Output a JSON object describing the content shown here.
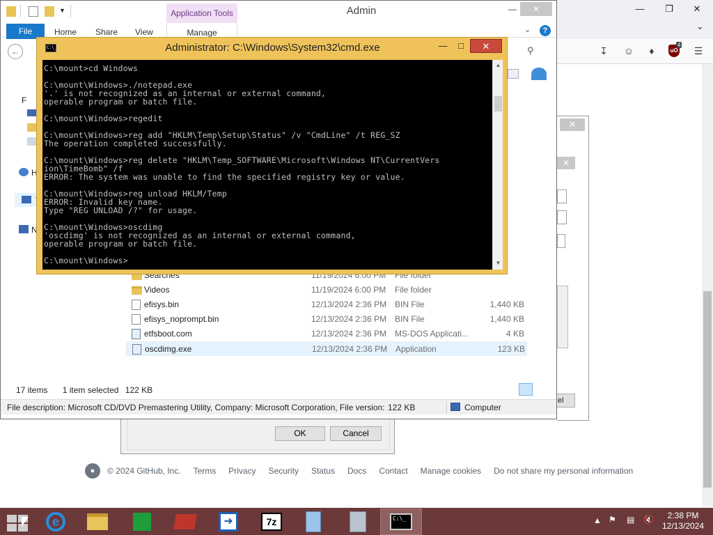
{
  "browser": {
    "footer": {
      "copyright": "© 2024 GitHub, Inc.",
      "links": [
        "Terms",
        "Privacy",
        "Security",
        "Status",
        "Docs",
        "Contact",
        "Manage cookies",
        "Do not share my personal information"
      ]
    },
    "ublock_count": "4"
  },
  "explorer": {
    "title": "Admin",
    "context_tab": "Application Tools",
    "ribbon_tabs": [
      "File",
      "Home",
      "Share",
      "View",
      "Manage"
    ],
    "nav_initials": [
      "F",
      "H",
      "T",
      "N"
    ],
    "files": [
      {
        "name": "Searches",
        "date": "11/19/2024 6:00 PM",
        "type": "File folder",
        "size": "",
        "icon": "folder"
      },
      {
        "name": "Videos",
        "date": "11/19/2024 6:00 PM",
        "type": "File folder",
        "size": "",
        "icon": "folder"
      },
      {
        "name": "efisys.bin",
        "date": "12/13/2024 2:36 PM",
        "type": "BIN File",
        "size": "1,440 KB",
        "icon": "doc"
      },
      {
        "name": "efisys_noprompt.bin",
        "date": "12/13/2024 2:36 PM",
        "type": "BIN File",
        "size": "1,440 KB",
        "icon": "doc"
      },
      {
        "name": "etfsboot.com",
        "date": "12/13/2024 2:36 PM",
        "type": "MS-DOS Applicati...",
        "size": "4 KB",
        "icon": "exe"
      },
      {
        "name": "oscdimg.exe",
        "date": "12/13/2024 2:36 PM",
        "type": "Application",
        "size": "123 KB",
        "icon": "exe"
      }
    ],
    "status": {
      "items": "17 items",
      "selected": "1 item selected",
      "selected_size": "122 KB"
    },
    "details": {
      "description": "File description: Microsoft CD/DVD Premastering Utility, Company: Microsoft Corporation, File version:",
      "size": "122 KB",
      "location": "Computer"
    }
  },
  "cmd": {
    "title": "Administrator: C:\\Windows\\System32\\cmd.exe",
    "icon_text": "C:\\_",
    "lines": [
      "C:\\mount>cd Windows",
      "",
      "C:\\mount\\Windows>./notepad.exe",
      "'.' is not recognized as an internal or external command,",
      "operable program or batch file.",
      "",
      "C:\\mount\\Windows>regedit",
      "",
      "C:\\mount\\Windows>reg add \"HKLM\\Temp\\Setup\\Status\" /v \"CmdLine\" /t REG_SZ",
      "The operation completed successfully.",
      "",
      "C:\\mount\\Windows>reg delete \"HKLM\\Temp_SOFTWARE\\Microsoft\\Windows NT\\CurrentVers",
      "ion\\TimeBomb\" /f",
      "ERROR: The system was unable to find the specified registry key or value.",
      "",
      "C:\\mount\\Windows>reg unload HKLM/Temp",
      "ERROR: Invalid key name.",
      "Type \"REG UNLOAD /?\" for usage.",
      "",
      "C:\\mount\\Windows>oscdimg",
      "'oscdimg' is not recognized as an internal or external command,",
      "operable program or batch file.",
      "",
      "C:\\mount\\Windows>"
    ]
  },
  "dialog": {
    "ok_label": "OK",
    "cancel_label": "Cancel",
    "partial_button": "el"
  },
  "taskbar": {
    "time": "2:38 PM",
    "date": "12/13/2024",
    "apps": [
      "internet-explorer",
      "file-explorer",
      "store",
      "winrar",
      "dism-tool",
      "7-zip",
      "setup",
      "installer",
      "command-prompt"
    ],
    "seven_zip_label": "7z"
  },
  "colors": {
    "cmd_frame": "#f0c35a",
    "taskbar": "#6b3939",
    "file_tab": "#1979ca",
    "context_tab": "#f1dff5"
  }
}
